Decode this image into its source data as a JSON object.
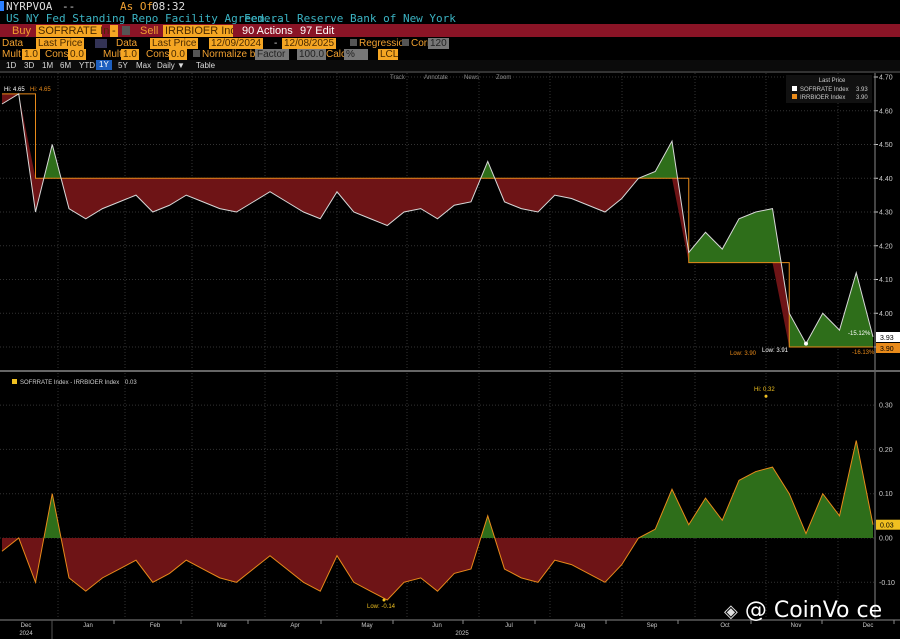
{
  "header": {
    "ticker": "NYRPVOA",
    "dash": "--",
    "as_of_label": "As Of",
    "time": "08:32",
    "description": "US NY Fed Standing Repo Facility Agreem...",
    "source": "Federal Reserve Bank of New York"
  },
  "trade_bar": {
    "buy_label": "Buy",
    "buy_value": "SOFRRATE Ind",
    "op": "-",
    "sell_label": "Sell",
    "sell_value": "IRRBIOER Inde",
    "actions": "90 Actions",
    "edit": "97 Edit"
  },
  "settings": {
    "data1_label": "Data",
    "data1": "Last Price",
    "data2_label": "Data",
    "data2": "Last Price",
    "start": "12/09/2024",
    "end": "12/08/2025",
    "sep": "-",
    "regression": "Regression",
    "corr": "Corr",
    "corr_val": "120",
    "mult1_label": "Mult",
    "mult1": "1.0",
    "const1_label": "Const",
    "const1": "0.0",
    "mult2_label": "Mult",
    "mult2": "1.0",
    "const2_label": "Const",
    "const2": "0.0",
    "normalize": "Normalize by",
    "factor": "Factor",
    "factor_val": "100.0",
    "calc": "Calc",
    "calc_val": "%",
    "lcl": "LCL"
  },
  "periods": [
    "1D",
    "3D",
    "1M",
    "6M",
    "YTD",
    "1Y",
    "5Y",
    "Max"
  ],
  "active_period": "1Y",
  "daily": "Daily ▼",
  "table": "Table",
  "toolbar": [
    "Track",
    "Annotate",
    "News",
    "Zoom"
  ],
  "colors": {
    "above": "#2e6e1a",
    "below": "#6e1416",
    "sofr": "#d8d8d8",
    "iorb": "#e88a1a",
    "hilo": "#f0c020"
  },
  "chart_data": [
    {
      "type": "area",
      "title": "",
      "legend_title": "Last Price",
      "legend": [
        {
          "name": "SOFRRATE Index",
          "last": "3.93"
        },
        {
          "name": "IRRBIOER Index",
          "last": "3.90"
        }
      ],
      "x": [
        "2024-12-09",
        "2024-12-16",
        "2024-12-23",
        "2024-12-30",
        "2025-01-06",
        "2025-01-13",
        "2025-01-20",
        "2025-01-27",
        "2025-02-03",
        "2025-02-10",
        "2025-02-17",
        "2025-02-24",
        "2025-03-03",
        "2025-03-10",
        "2025-03-17",
        "2025-03-24",
        "2025-03-31",
        "2025-04-07",
        "2025-04-14",
        "2025-04-21",
        "2025-04-28",
        "2025-05-05",
        "2025-05-12",
        "2025-05-19",
        "2025-05-26",
        "2025-06-02",
        "2025-06-09",
        "2025-06-16",
        "2025-06-23",
        "2025-06-30",
        "2025-07-07",
        "2025-07-14",
        "2025-07-21",
        "2025-07-28",
        "2025-08-04",
        "2025-08-11",
        "2025-08-18",
        "2025-08-25",
        "2025-09-01",
        "2025-09-08",
        "2025-09-15",
        "2025-09-22",
        "2025-09-29",
        "2025-10-06",
        "2025-10-13",
        "2025-10-20",
        "2025-10-27",
        "2025-11-03",
        "2025-11-10",
        "2025-11-17",
        "2025-11-24",
        "2025-12-01",
        "2025-12-08"
      ],
      "series": [
        {
          "name": "SOFRRATE Index",
          "values": [
            4.62,
            4.65,
            4.3,
            4.5,
            4.31,
            4.28,
            4.31,
            4.33,
            4.35,
            4.3,
            4.32,
            4.35,
            4.33,
            4.31,
            4.3,
            4.33,
            4.36,
            4.33,
            4.3,
            4.28,
            4.36,
            4.3,
            4.28,
            4.26,
            4.3,
            4.31,
            4.28,
            4.32,
            4.33,
            4.45,
            4.33,
            4.31,
            4.3,
            4.35,
            4.34,
            4.32,
            4.3,
            4.34,
            4.4,
            4.42,
            4.51,
            4.18,
            4.24,
            4.19,
            4.28,
            4.3,
            4.31,
            4.0,
            3.91,
            4.0,
            3.95,
            4.12,
            3.93
          ]
        },
        {
          "name": "IRRBIOER Index",
          "values": [
            4.65,
            4.65,
            4.4,
            4.4,
            4.4,
            4.4,
            4.4,
            4.4,
            4.4,
            4.4,
            4.4,
            4.4,
            4.4,
            4.4,
            4.4,
            4.4,
            4.4,
            4.4,
            4.4,
            4.4,
            4.4,
            4.4,
            4.4,
            4.4,
            4.4,
            4.4,
            4.4,
            4.4,
            4.4,
            4.4,
            4.4,
            4.4,
            4.4,
            4.4,
            4.4,
            4.4,
            4.4,
            4.4,
            4.4,
            4.4,
            4.4,
            4.15,
            4.15,
            4.15,
            4.15,
            4.15,
            4.15,
            3.9,
            3.9,
            3.9,
            3.9,
            3.9,
            3.9
          ]
        }
      ],
      "ylim": [
        3.9,
        4.7
      ],
      "yticks": [
        "4.70",
        "4.60",
        "4.50",
        "4.40",
        "4.30",
        "4.20",
        "4.10",
        "4.00",
        "3.90"
      ],
      "annotations": {
        "hi": "Hi: 4.65",
        "hi2": "Hi: 4.65",
        "low_sofr": "Low: 3.91",
        "low_iorb": "Low: 3.90",
        "chg_sofr": "-15.12%",
        "chg_iorb": "-16.13%",
        "last_sofr": "3.93",
        "last_iorb": "3.90"
      }
    },
    {
      "type": "area",
      "legend": [
        {
          "name": "SOFRRATE Index - IRRBIOER Index",
          "last": "0.03"
        }
      ],
      "derived": "SOFRRATE Index - IRRBIOER Index",
      "ylim": [
        -0.15,
        0.33
      ],
      "yticks": [
        "0.30",
        "0.20",
        "0.10",
        "0.00",
        "-0.10"
      ],
      "annotations": {
        "hi": "Hi: 0.32",
        "low": "Low: -0.14",
        "last": "0.03"
      }
    }
  ],
  "xaxis": {
    "months": [
      "Dec",
      "Jan",
      "Feb",
      "Mar",
      "Apr",
      "May",
      "Jun",
      "Jul",
      "Aug",
      "Sep",
      "Oct",
      "Nov",
      "Dec"
    ],
    "year1": "2024",
    "year2": "2025"
  },
  "watermark": "@ CoinVo ce"
}
